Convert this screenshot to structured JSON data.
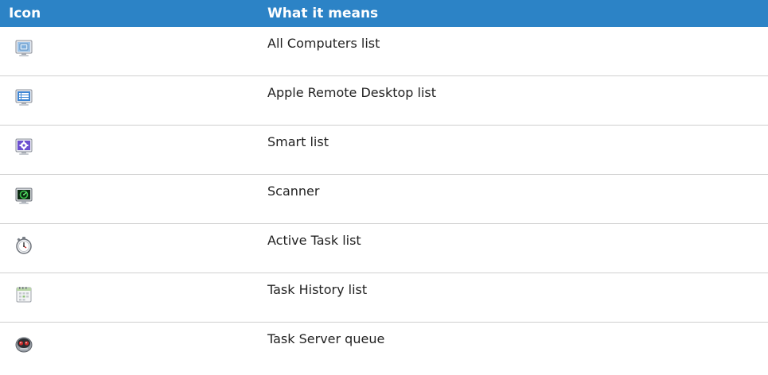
{
  "header": {
    "icon_col": "Icon",
    "meaning_col": "What it means"
  },
  "rows": [
    {
      "icon": "all-computers-list-icon",
      "label": "All Computers list"
    },
    {
      "icon": "apple-remote-desktop-list-icon",
      "label": "Apple Remote Desktop list"
    },
    {
      "icon": "smart-list-icon",
      "label": "Smart list"
    },
    {
      "icon": "scanner-icon",
      "label": "Scanner"
    },
    {
      "icon": "active-task-list-icon",
      "label": "Active Task list"
    },
    {
      "icon": "task-history-list-icon",
      "label": "Task History list"
    },
    {
      "icon": "task-server-queue-icon",
      "label": "Task Server queue"
    }
  ],
  "colors": {
    "header_bg": "#2c83c6",
    "header_text": "#ffffff",
    "row_divider": "#cfcfcf"
  }
}
